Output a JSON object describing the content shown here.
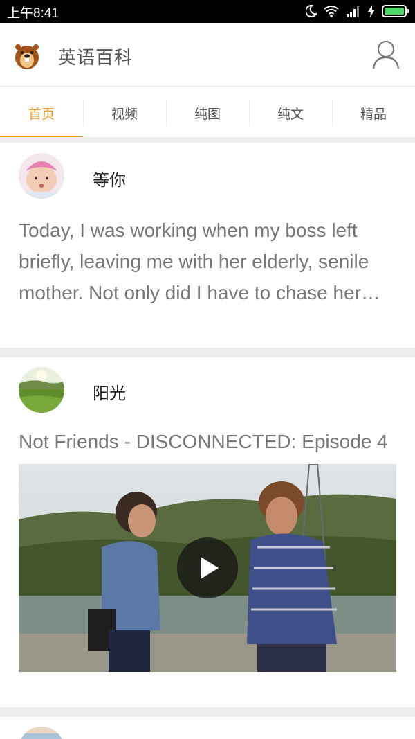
{
  "status_bar": {
    "time": "上午8:41",
    "icons": [
      "moon-icon",
      "wifi-icon",
      "signal-icon",
      "charging-icon",
      "battery-icon"
    ],
    "battery_color": "#4cd964"
  },
  "app": {
    "title": "英语百科",
    "logo": "beaver-logo",
    "user_icon": "user-icon",
    "accent_color": "#f59722"
  },
  "tabs": [
    {
      "label": "首页",
      "active": true
    },
    {
      "label": "视频",
      "active": false
    },
    {
      "label": "纯图",
      "active": false
    },
    {
      "label": "纯文",
      "active": false
    },
    {
      "label": "精品",
      "active": false
    }
  ],
  "feed": [
    {
      "type": "text",
      "username": "等你",
      "avatar": "baby-photo",
      "text": "Today, I was working when my boss left briefly, leaving me with her elderly, senile mother. Not only did I have to chase her around the office…"
    },
    {
      "type": "video",
      "username": "阳光",
      "avatar": "meadow-photo",
      "title": "Not Friends - DISCONNECTED: Episode 4",
      "play_icon": "play-icon"
    }
  ]
}
